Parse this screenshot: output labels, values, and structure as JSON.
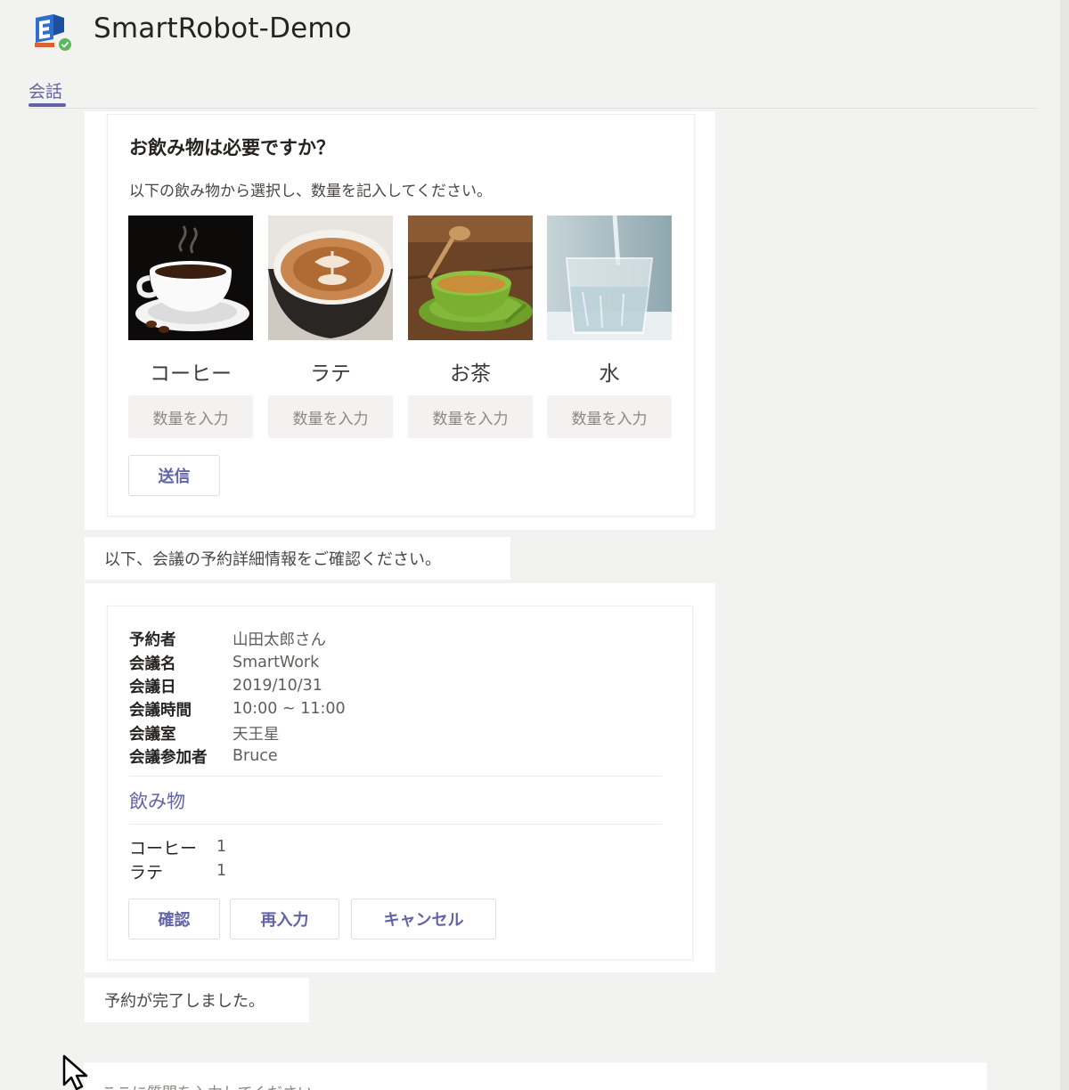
{
  "header": {
    "app_title": "SmartRobot-Demo",
    "logo_icon": "smartrobot-logo-icon"
  },
  "tabs": [
    {
      "label": "会話",
      "active": true
    }
  ],
  "drink_card": {
    "title": "お飲み物は必要ですか？",
    "subtitle": "以下の飲み物から選択し、数量を記入してください。",
    "drinks": [
      {
        "name": "コーヒー",
        "image": "coffee-image",
        "qty_placeholder": "数量を入力"
      },
      {
        "name": "ラテ",
        "image": "latte-image",
        "qty_placeholder": "数量を入力"
      },
      {
        "name": "お茶",
        "image": "tea-image",
        "qty_placeholder": "数量を入力"
      },
      {
        "name": "水",
        "image": "water-image",
        "qty_placeholder": "数量を入力"
      }
    ],
    "submit_label": "送信"
  },
  "messages": {
    "confirm_prompt": "以下、会議の予約詳細情報をご確認ください。",
    "done": "予約が完了しました。"
  },
  "reservation_card": {
    "details": [
      {
        "label": "予約者",
        "value": "山田太郎さん"
      },
      {
        "label": "会議名",
        "value": "SmartWork"
      },
      {
        "label": "会議日",
        "value": "2019/10/31"
      },
      {
        "label": "会議時間",
        "value": "10:00 ~ 11:00"
      },
      {
        "label": "会議室",
        "value": "天王星"
      },
      {
        "label": "会議参加者",
        "value": "Bruce"
      }
    ],
    "drinks_heading": "飲み物",
    "ordered": [
      {
        "name": "コーヒー",
        "qty": "1"
      },
      {
        "name": "ラテ",
        "qty": "1"
      }
    ],
    "buttons": {
      "confirm": "確認",
      "reenter": "再入力",
      "cancel": "キャンセル"
    }
  },
  "compose": {
    "placeholder": "ここに質問を入力してください"
  },
  "colors": {
    "accent": "#6264a7",
    "background": "#f2f2f1",
    "card": "#ffffff"
  }
}
